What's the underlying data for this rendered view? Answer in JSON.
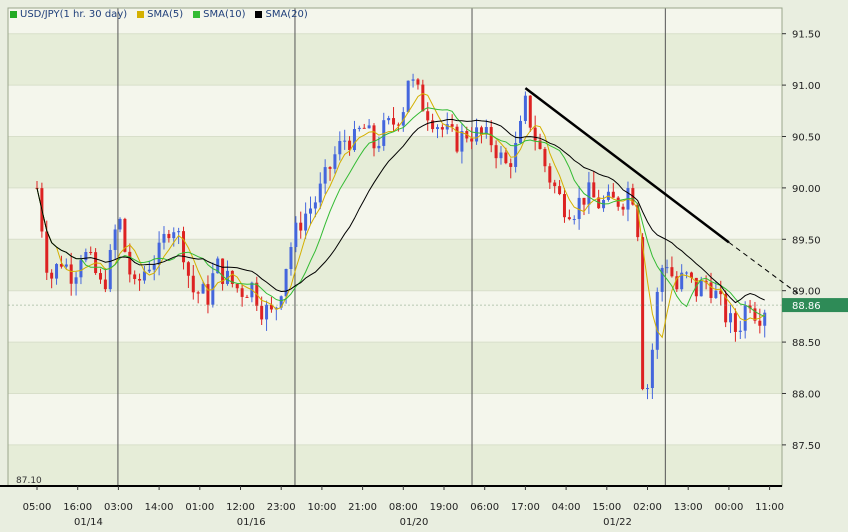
{
  "chart_data": {
    "type": "candlestick",
    "symbol": "USD/JPY",
    "legend": [
      {
        "label": "USD/JPY(1 hr. 30 day)",
        "color": "#22aa22"
      },
      {
        "label": "SMA(5)",
        "color": "#d4b000"
      },
      {
        "label": "SMA(10)",
        "color": "#33bb33"
      },
      {
        "label": "SMA(20)",
        "color": "#000000"
      }
    ],
    "ylim": [
      87.1,
      91.75
    ],
    "y_ticks": [
      "91.50",
      "91.00",
      "90.50",
      "90.00",
      "89.50",
      "89.00",
      "88.50",
      "88.00",
      "87.50"
    ],
    "y_tick_values": [
      91.5,
      91.0,
      90.5,
      90.0,
      89.5,
      89.0,
      88.5,
      88.0,
      87.5
    ],
    "bottom_label": "87.10",
    "current_price": "88.86",
    "current_price_value": 88.86,
    "x_ticks": [
      "05:00",
      "16:00",
      "03:00",
      "14:00",
      "01:00",
      "12:00",
      "23:00",
      "10:00",
      "21:00",
      "08:00",
      "19:00",
      "06:00",
      "17:00",
      "04:00",
      "15:00",
      "02:00",
      "13:00",
      "00:00",
      "11:00"
    ],
    "date_labels": [
      {
        "label": "01/14",
        "index": 2
      },
      {
        "label": "01/16",
        "index": 6
      },
      {
        "label": "01/20",
        "index": 10
      },
      {
        "label": "01/22",
        "index": 15
      }
    ],
    "trendline": {
      "start": [
        12.0,
        90.97
      ],
      "end": [
        17.0,
        89.47
      ],
      "extend_to": [
        18.7,
        88.97
      ]
    },
    "price_path": [
      [
        0,
        90.0
      ],
      [
        0.3,
        89.1
      ],
      [
        0.6,
        89.3
      ],
      [
        0.9,
        89.15
      ],
      [
        1.1,
        89.4
      ],
      [
        1.4,
        89.2
      ],
      [
        1.6,
        89.0
      ],
      [
        1.8,
        89.3
      ],
      [
        2.0,
        89.75
      ],
      [
        2.2,
        89.3
      ],
      [
        2.4,
        89.0
      ],
      [
        2.7,
        89.25
      ],
      [
        3.0,
        89.35
      ],
      [
        3.3,
        89.7
      ],
      [
        3.6,
        89.4
      ],
      [
        3.8,
        89.0
      ],
      [
        4.2,
        88.95
      ],
      [
        4.4,
        89.25
      ],
      [
        4.7,
        89.1
      ],
      [
        5.0,
        89.0
      ],
      [
        5.3,
        89.05
      ],
      [
        5.5,
        88.85
      ],
      [
        5.8,
        88.75
      ],
      [
        6.0,
        89.05
      ],
      [
        6.2,
        89.4
      ],
      [
        6.5,
        89.7
      ],
      [
        6.8,
        89.85
      ],
      [
        7.0,
        90.0
      ],
      [
        7.3,
        90.3
      ],
      [
        7.6,
        90.5
      ],
      [
        7.8,
        90.45
      ],
      [
        8.0,
        90.6
      ],
      [
        8.3,
        90.4
      ],
      [
        8.5,
        90.55
      ],
      [
        8.8,
        90.65
      ],
      [
        9.0,
        90.8
      ],
      [
        9.1,
        91.1
      ],
      [
        9.3,
        90.95
      ],
      [
        9.5,
        90.8
      ],
      [
        9.7,
        90.7
      ],
      [
        10.0,
        90.55
      ],
      [
        10.3,
        90.45
      ],
      [
        10.6,
        90.55
      ],
      [
        10.9,
        90.5
      ],
      [
        11.2,
        90.45
      ],
      [
        11.5,
        90.2
      ],
      [
        11.8,
        90.4
      ],
      [
        12.0,
        90.8
      ],
      [
        12.2,
        90.55
      ],
      [
        12.4,
        90.3
      ],
      [
        12.6,
        90.1
      ],
      [
        12.9,
        89.85
      ],
      [
        13.2,
        89.8
      ],
      [
        13.5,
        89.95
      ],
      [
        13.8,
        89.85
      ],
      [
        14.1,
        89.85
      ],
      [
        14.4,
        89.9
      ],
      [
        14.6,
        90.05
      ],
      [
        14.8,
        89.5
      ],
      [
        14.9,
        87.8
      ],
      [
        15.1,
        88.35
      ],
      [
        15.3,
        89.2
      ],
      [
        15.5,
        89.3
      ],
      [
        15.7,
        89.0
      ],
      [
        15.9,
        89.15
      ],
      [
        16.2,
        89.0
      ],
      [
        16.5,
        89.1
      ],
      [
        16.8,
        88.85
      ],
      [
        17.0,
        88.7
      ],
      [
        17.2,
        88.6
      ],
      [
        17.5,
        88.95
      ],
      [
        17.7,
        88.75
      ],
      [
        17.9,
        88.86
      ]
    ]
  }
}
